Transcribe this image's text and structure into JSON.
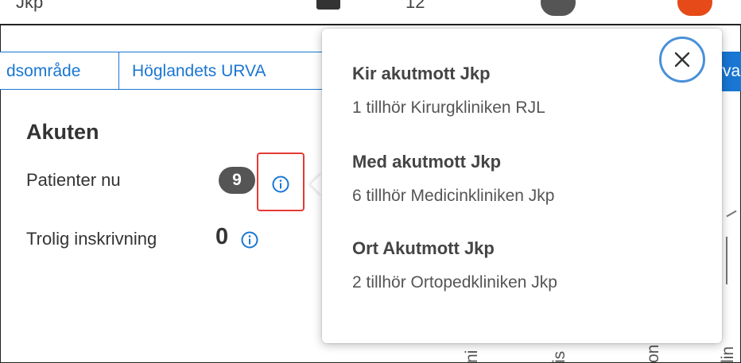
{
  "top_strip": {
    "cut_left_text": "Jkp",
    "cut_number": "12"
  },
  "tabs": [
    {
      "label": "dsområde"
    },
    {
      "label": "Höglandets URVA"
    }
  ],
  "right_tab_fragment": "rva",
  "section": {
    "title": "Akuten",
    "patients_label": "Patienter nu",
    "patients_count": "9",
    "likely_admission_label": "Trolig inskrivning",
    "likely_admission_count": "0"
  },
  "popover": {
    "items": [
      {
        "title": "Kir akutmott Jkp",
        "detail": "1 tillhör Kirurgkliniken RJL"
      },
      {
        "title": "Med akutmott Jkp",
        "detail": "6 tillhör Medicinkliniken Jkp"
      },
      {
        "title": "Ort Akutmott Jkp",
        "detail": "2 tillhör Ortopedkliniken Jkp"
      }
    ],
    "close_icon": "close-icon"
  },
  "background_fragments": [
    "ni",
    "is",
    "on",
    "lin"
  ],
  "colors": {
    "accent_blue": "#1976d2",
    "badge_gray": "#555555",
    "highlight_red": "#e53935",
    "close_ring": "#4a90d9"
  }
}
